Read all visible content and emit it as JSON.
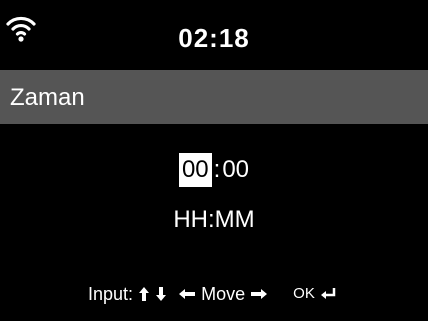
{
  "status_bar": {
    "wifi_icon": "wifi-icon",
    "time": "02:18"
  },
  "menu": {
    "title": "Zaman"
  },
  "time_editor": {
    "hours": "00",
    "separator": ":",
    "minutes": "00",
    "format": "HH:MM",
    "highlight_color": "#ffffff"
  },
  "hints": {
    "input_label": "Input:",
    "move_label": "Move",
    "ok_label": "OK",
    "icons": [
      "arrow-up-icon",
      "arrow-down-icon",
      "arrow-left-icon",
      "arrow-right-icon",
      "enter-icon"
    ]
  }
}
